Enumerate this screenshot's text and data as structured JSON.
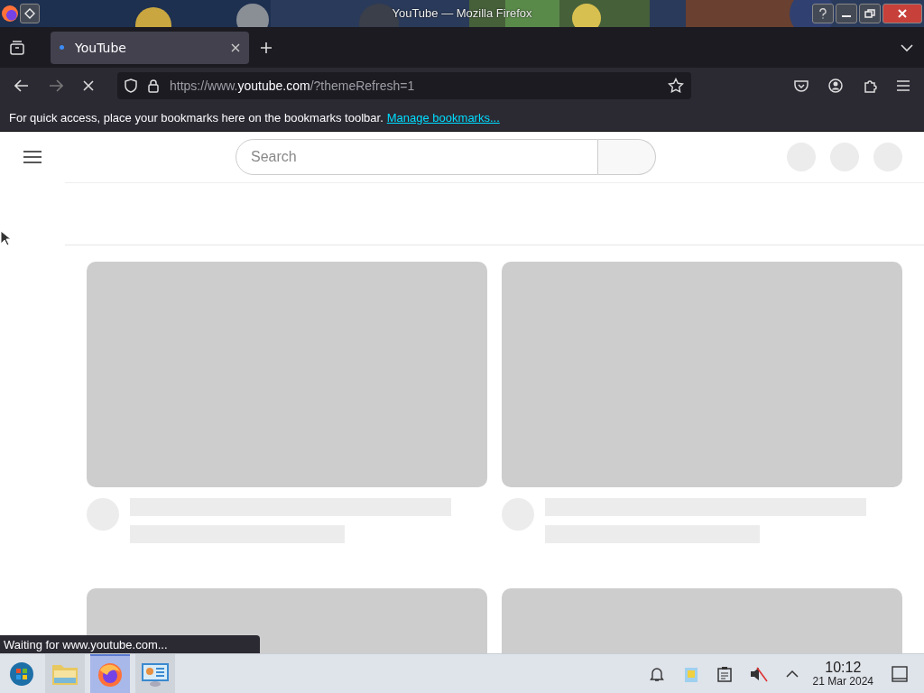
{
  "window": {
    "title": "YouTube — Mozilla Firefox"
  },
  "tabs": [
    {
      "label": "YouTube",
      "selected": true
    }
  ],
  "address_bar": {
    "prefix": "https://www.",
    "domain": "youtube.com",
    "suffix": "/?themeRefresh=1"
  },
  "bookmarks_toolbar": {
    "message": "For quick access, place your bookmarks here on the bookmarks toolbar.",
    "link": "Manage bookmarks..."
  },
  "page": {
    "search": {
      "placeholder": "Search"
    }
  },
  "status_bar": {
    "text": "Waiting for www.youtube.com..."
  },
  "taskbar": {
    "apps": [
      {
        "kind": "folder",
        "selected": false
      },
      {
        "kind": "browser",
        "selected": true
      },
      {
        "kind": "monitor",
        "selected": false
      }
    ],
    "clock": {
      "time": "10:12",
      "date": "21 Mar 2024"
    },
    "tray": {
      "muted": true
    }
  }
}
